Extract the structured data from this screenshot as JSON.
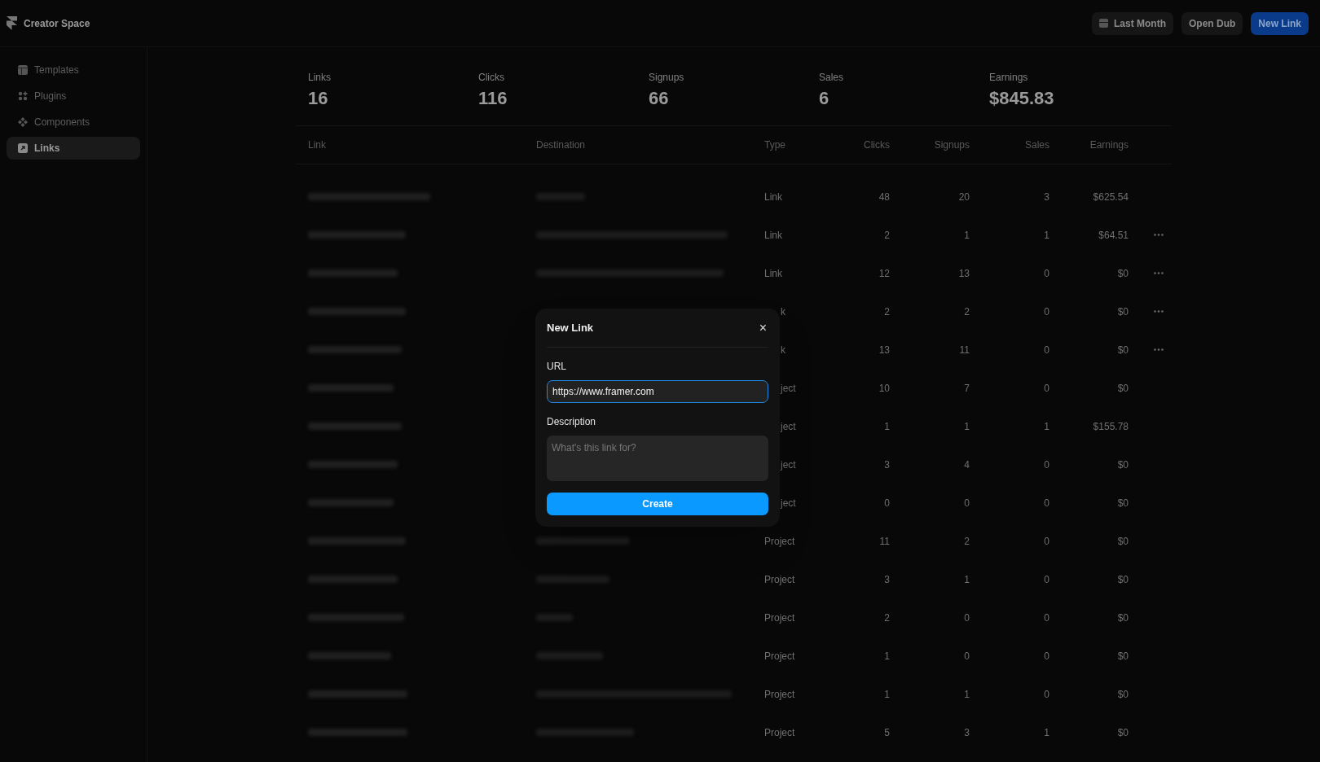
{
  "app": {
    "title": "Creator Space"
  },
  "sidebar": {
    "items": [
      {
        "label": "Templates",
        "selected": false
      },
      {
        "label": "Plugins",
        "selected": false
      },
      {
        "label": "Components",
        "selected": false
      },
      {
        "label": "Links",
        "selected": true
      }
    ]
  },
  "toolbar": [
    {
      "label": "Last Month",
      "kind": "date"
    },
    {
      "label": "Open Dub",
      "kind": "plain"
    },
    {
      "label": "New Link",
      "kind": "primary"
    }
  ],
  "stats": [
    {
      "label": "Links",
      "value": "16"
    },
    {
      "label": "Clicks",
      "value": "116"
    },
    {
      "label": "Signups",
      "value": "66"
    },
    {
      "label": "Sales",
      "value": "6"
    },
    {
      "label": "Earnings",
      "value": "$845.83"
    }
  ],
  "table": {
    "columns": [
      "Link",
      "Destination",
      "Type",
      "Clicks",
      "Signups",
      "Sales",
      "Earnings"
    ],
    "rows": [
      {
        "type": "Link",
        "clicks": "48",
        "signups": "20",
        "sales": "3",
        "earnings": "$625.54",
        "menu": false
      },
      {
        "type": "Link",
        "clicks": "2",
        "signups": "1",
        "sales": "1",
        "earnings": "$64.51",
        "menu": true
      },
      {
        "type": "Link",
        "clicks": "12",
        "signups": "13",
        "sales": "0",
        "earnings": "$0",
        "menu": true
      },
      {
        "type": "k",
        "clicks": "2",
        "signups": "2",
        "sales": "0",
        "earnings": "$0",
        "menu": true
      },
      {
        "type": "k",
        "clicks": "13",
        "signups": "11",
        "sales": "0",
        "earnings": "$0",
        "menu": true
      },
      {
        "type": "ject",
        "clicks": "10",
        "signups": "7",
        "sales": "0",
        "earnings": "$0",
        "menu": false
      },
      {
        "type": "ject",
        "clicks": "1",
        "signups": "1",
        "sales": "1",
        "earnings": "$155.78",
        "menu": false
      },
      {
        "type": "ject",
        "clicks": "3",
        "signups": "4",
        "sales": "0",
        "earnings": "$0",
        "menu": false
      },
      {
        "type": "ject",
        "clicks": "0",
        "signups": "0",
        "sales": "0",
        "earnings": "$0",
        "menu": false
      },
      {
        "type": "Project",
        "clicks": "11",
        "signups": "2",
        "sales": "0",
        "earnings": "$0",
        "menu": false
      },
      {
        "type": "Project",
        "clicks": "3",
        "signups": "1",
        "sales": "0",
        "earnings": "$0",
        "menu": false
      },
      {
        "type": "Project",
        "clicks": "2",
        "signups": "0",
        "sales": "0",
        "earnings": "$0",
        "menu": false
      },
      {
        "type": "Project",
        "clicks": "1",
        "signups": "0",
        "sales": "0",
        "earnings": "$0",
        "menu": false
      },
      {
        "type": "Project",
        "clicks": "1",
        "signups": "1",
        "sales": "0",
        "earnings": "$0",
        "menu": false
      },
      {
        "type": "Project",
        "clicks": "5",
        "signups": "3",
        "sales": "1",
        "earnings": "$0",
        "menu": false
      }
    ]
  },
  "dialog": {
    "title": "New Link",
    "close": "×",
    "url_label": "URL",
    "url_value": "https://www.framer.com",
    "description_label": "Description",
    "description_placeholder": "What's this link for?",
    "submit": "Create"
  }
}
